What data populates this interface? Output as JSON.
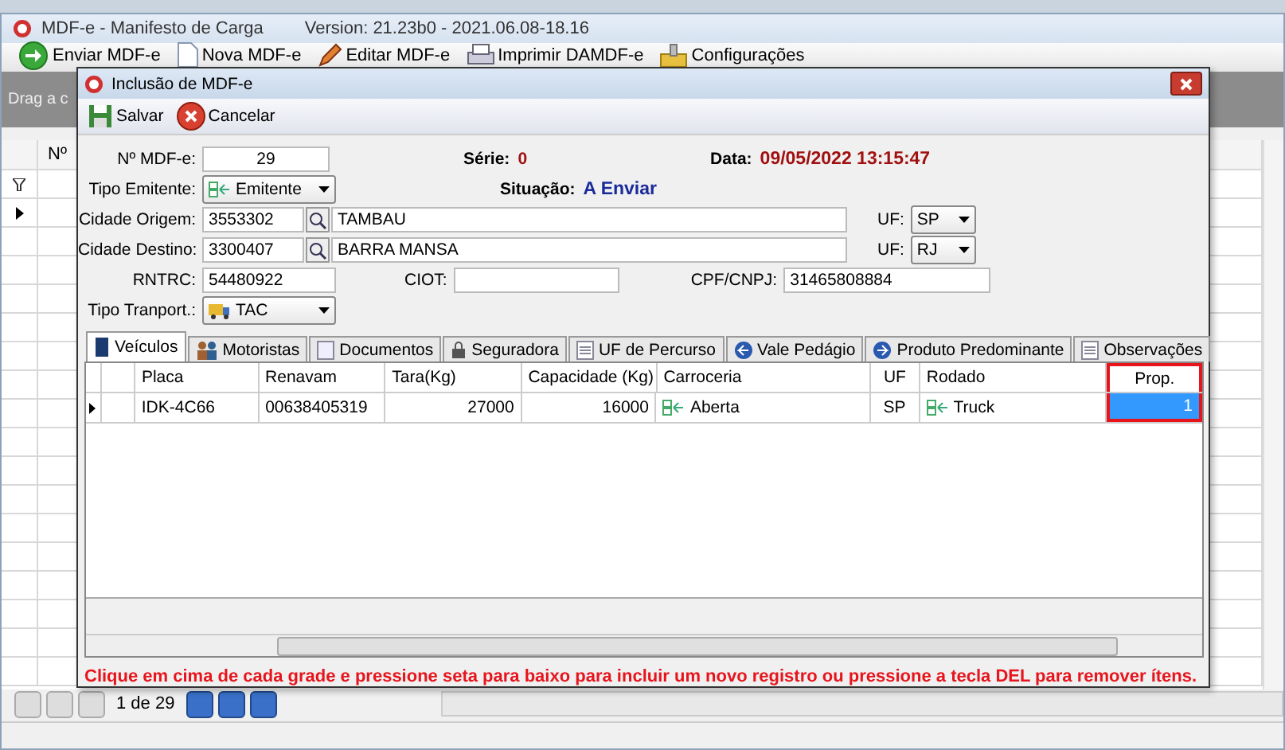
{
  "main_window": {
    "title": "MDF-e - Manifesto de Carga",
    "version": "Version: 21.23b0 - 2021.06.08-18.16",
    "toolbar": [
      {
        "label": "Enviar MDF-e"
      },
      {
        "label": "Nova MDF-e"
      },
      {
        "label": "Editar MDF-e"
      },
      {
        "label": "Imprimir DAMDF-e"
      },
      {
        "label": "Configurações"
      }
    ],
    "group_panel": "Drag a c",
    "grid": {
      "columns": [
        "Nº"
      ]
    },
    "navigator": {
      "record": "1 de 29"
    }
  },
  "dialog": {
    "title": "Inclusão de MDF-e",
    "toolbar": [
      {
        "label": "Salvar"
      },
      {
        "label": "Cancelar"
      }
    ],
    "numero": {
      "label": "Nº MDF-e:",
      "value": "29"
    },
    "serie": {
      "label": "Série:",
      "value": "0"
    },
    "data": {
      "label": "Data:",
      "value": "09/05/2022 13:15:47"
    },
    "tipo_emitente": {
      "label": "Tipo Emitente:",
      "value": "Emitente"
    },
    "situacao": {
      "label": "Situação:",
      "value": "A Enviar"
    },
    "cidade_origem": {
      "label": "Cidade Origem:",
      "code": "3553302",
      "name": "TAMBAU",
      "uf_label": "UF:",
      "uf": "SP"
    },
    "cidade_destino": {
      "label": "Cidade Destino:",
      "code": "3300407",
      "name": "BARRA MANSA",
      "uf_label": "UF:",
      "uf": "RJ"
    },
    "rntrc": {
      "label": "RNTRC:",
      "value": "54480922"
    },
    "ciot": {
      "label": "CIOT:"
    },
    "cpf_cnpj": {
      "label": "CPF/CNPJ:",
      "value": "31465808884"
    },
    "tipo_transport": {
      "label": "Tipo Tranport.:",
      "value": "TAC"
    },
    "tabs": [
      {
        "label": "Veículos",
        "selected": true
      },
      {
        "label": "Motoristas",
        "selected": false
      },
      {
        "label": "Documentos",
        "selected": false
      },
      {
        "label": "Seguradora",
        "selected": false
      },
      {
        "label": "UF de Percurso",
        "selected": false
      },
      {
        "label": "Vale Pedágio",
        "selected": false
      },
      {
        "label": "Produto Predominante",
        "selected": false
      },
      {
        "label": "Observações",
        "selected": false
      }
    ],
    "grid": {
      "columns": [
        {
          "label": "Placa",
          "highlighted": false
        },
        {
          "label": "Renavam",
          "highlighted": false
        },
        {
          "label": "Tara(Kg)",
          "highlighted": false
        },
        {
          "label": "Capacidade (Kg)",
          "highlighted": false
        },
        {
          "label": "Carroceria",
          "highlighted": false
        },
        {
          "label": "UF",
          "highlighted": false
        },
        {
          "label": "Rodado",
          "highlighted": false
        },
        {
          "label": "Prop.",
          "highlighted": true
        }
      ],
      "rows": [
        {
          "selected": true,
          "cells": [
            "IDK-4C66",
            "00638405319",
            "27000",
            "16000",
            "Aberta",
            "SP",
            "Truck",
            "1"
          ]
        }
      ]
    },
    "message": "Clique em cima de cada grade e pressione seta para baixo para incluir um novo registro ou pressione a tecla DEL para remover ítens."
  }
}
